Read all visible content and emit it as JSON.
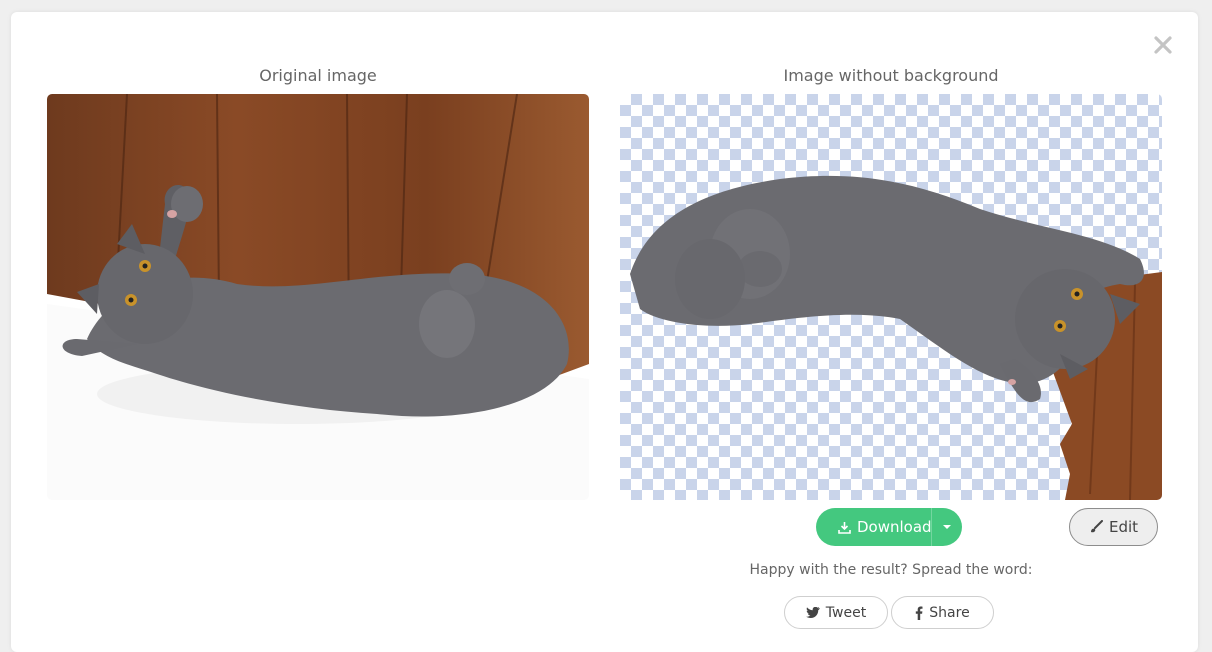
{
  "modal": {
    "close_icon": "close-icon"
  },
  "original": {
    "title": "Original image"
  },
  "result": {
    "title": "Image without background"
  },
  "actions": {
    "download_label": "Download",
    "edit_label": "Edit",
    "download_color": "#44c87f"
  },
  "share": {
    "prompt": "Happy with the result? Spread the word:",
    "tweet_label": "Tweet",
    "share_label": "Share"
  }
}
